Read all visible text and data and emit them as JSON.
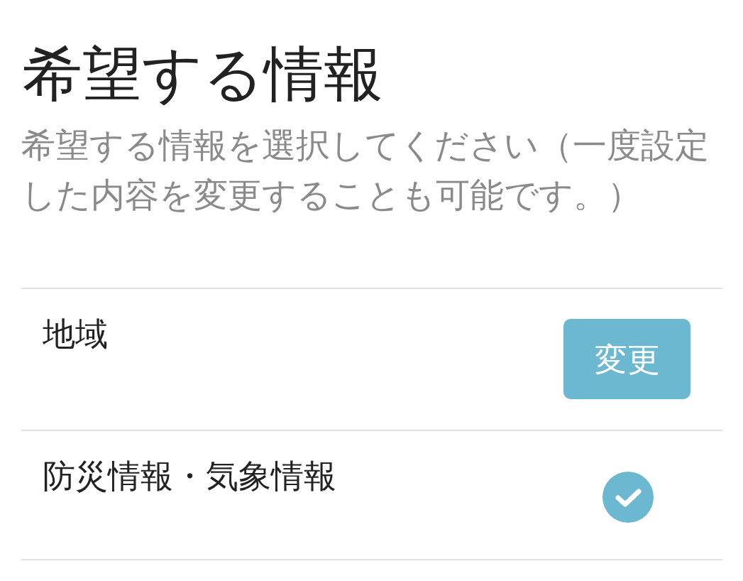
{
  "header": {
    "title": "希望する情報",
    "description": "希望する情報を選択してください（一度設定した内容を変更することも可能です。）"
  },
  "items": [
    {
      "kind": "button",
      "label": "地域",
      "button": "変更"
    },
    {
      "kind": "check",
      "label": "防災情報・気象情報",
      "checked": true
    }
  ]
}
